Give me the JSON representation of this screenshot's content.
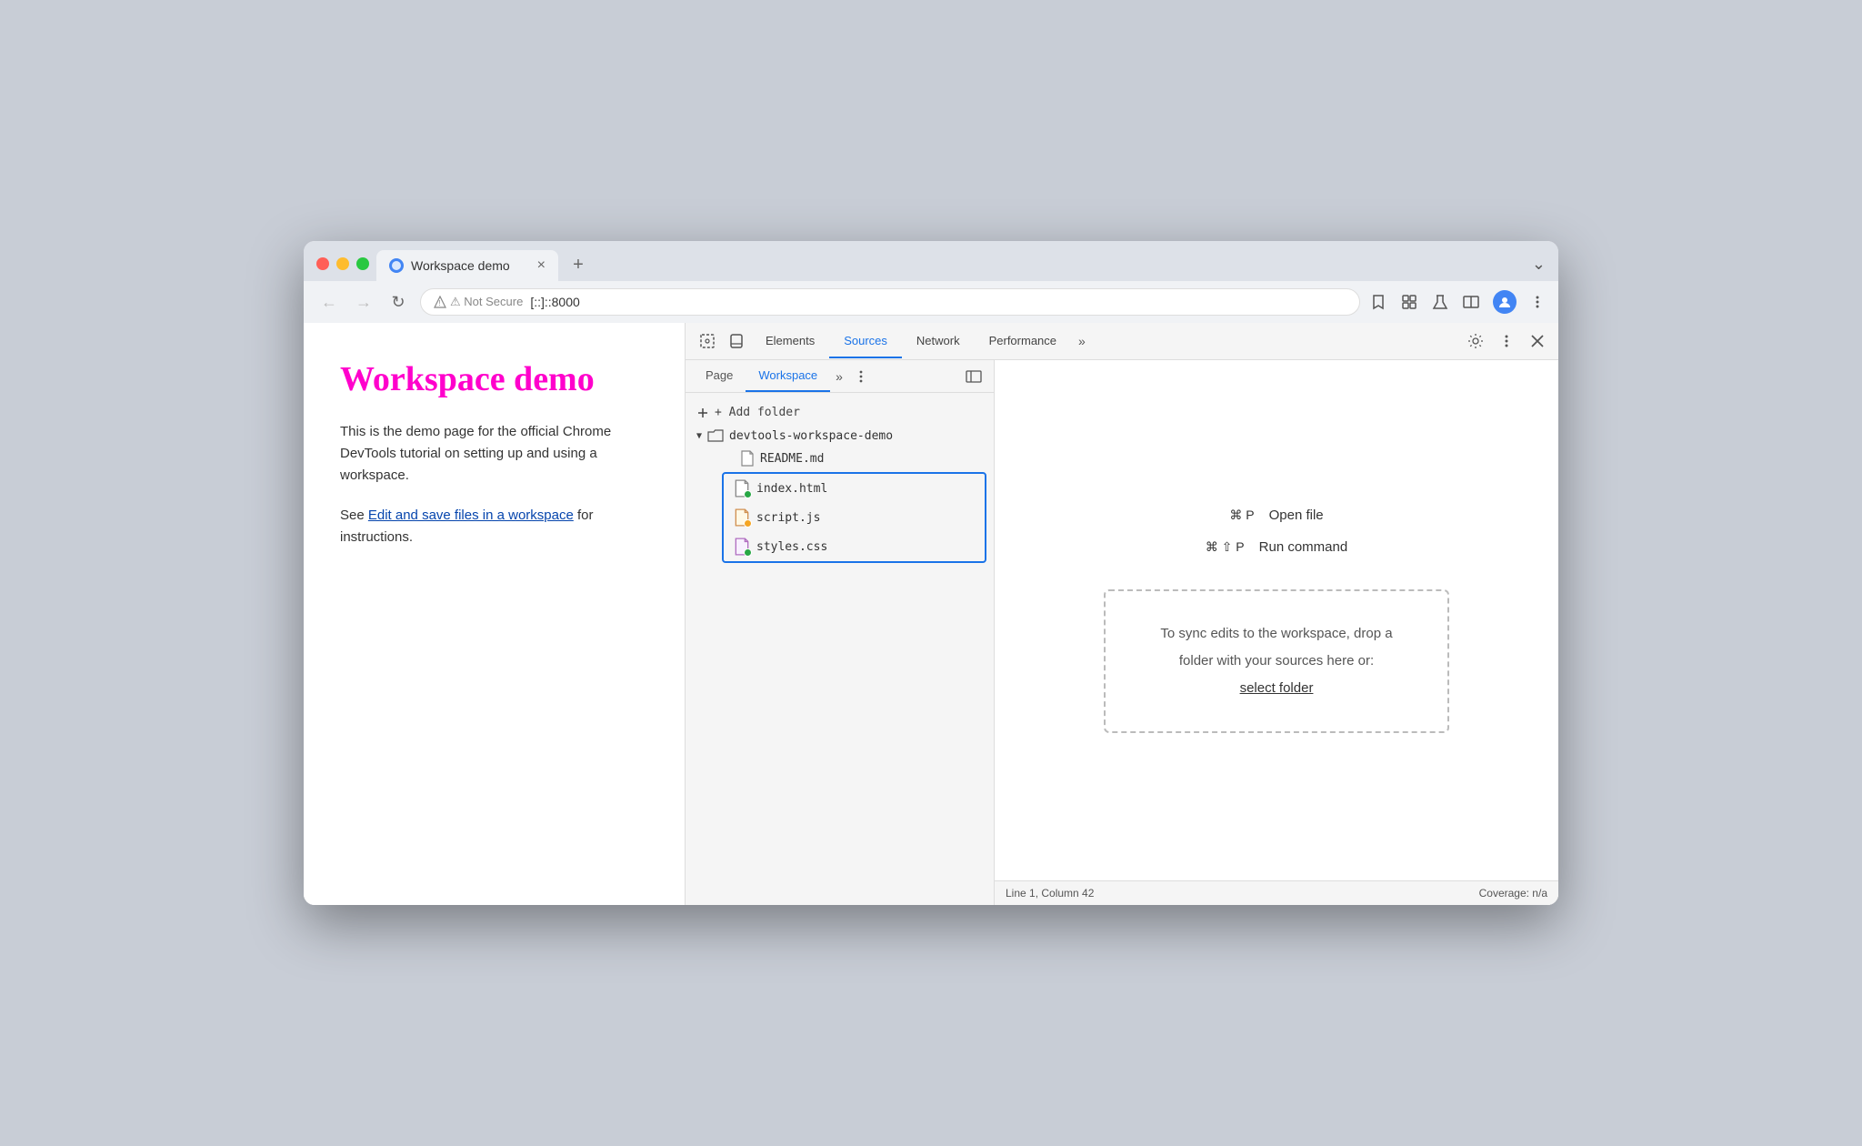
{
  "browser": {
    "tab_title": "Workspace demo",
    "tab_close": "×",
    "tab_new": "+",
    "tab_more": "⌄",
    "address_warning": "⚠ Not Secure",
    "address_url": "[::]::8000",
    "nav_back": "←",
    "nav_forward": "→",
    "nav_reload": "↻"
  },
  "webpage": {
    "title": "Workspace demo",
    "body_text": "This is the demo page for the official Chrome DevTools tutorial on setting up and using a workspace.",
    "see_text": "See ",
    "link_text": "Edit and save files in a workspace",
    "after_link": " for instructions."
  },
  "devtools": {
    "tabs": [
      "Elements",
      "Sources",
      "Network",
      "Performance"
    ],
    "active_tab": "Sources",
    "tab_more": "»",
    "icons": {
      "inspect": "⬚",
      "device": "☐",
      "settings": "⚙",
      "more": "⋮",
      "close": "×",
      "collapse_right": "⟩⟩"
    }
  },
  "sources_panel": {
    "subtabs": [
      "Page",
      "Workspace"
    ],
    "active_subtab": "Workspace",
    "subtab_more": "»",
    "add_folder": "+ Add folder",
    "folder_name": "devtools-workspace-demo",
    "files": [
      {
        "name": "README.md",
        "dot_color": null,
        "dot": false,
        "icon_color": "#888"
      },
      {
        "name": "index.html",
        "dot_color": "#28a745",
        "dot": true,
        "icon_color": "#fff"
      },
      {
        "name": "script.js",
        "dot_color": "#f5a623",
        "dot": true,
        "icon_color": "#f5a623"
      },
      {
        "name": "styles.css",
        "dot_color": "#28a745",
        "dot": true,
        "icon_color": "#c084fc"
      }
    ],
    "shortcut1_keys": "⌘ P",
    "shortcut1_label": "Open file",
    "shortcut2_keys": "⌘ ⇧ P",
    "shortcut2_label": "Run command",
    "drop_zone_text": "To sync edits to the workspace, drop a folder with your sources here or:",
    "select_folder": "select folder",
    "statusbar_left": "Line 1, Column 42",
    "statusbar_right": "Coverage: n/a"
  }
}
